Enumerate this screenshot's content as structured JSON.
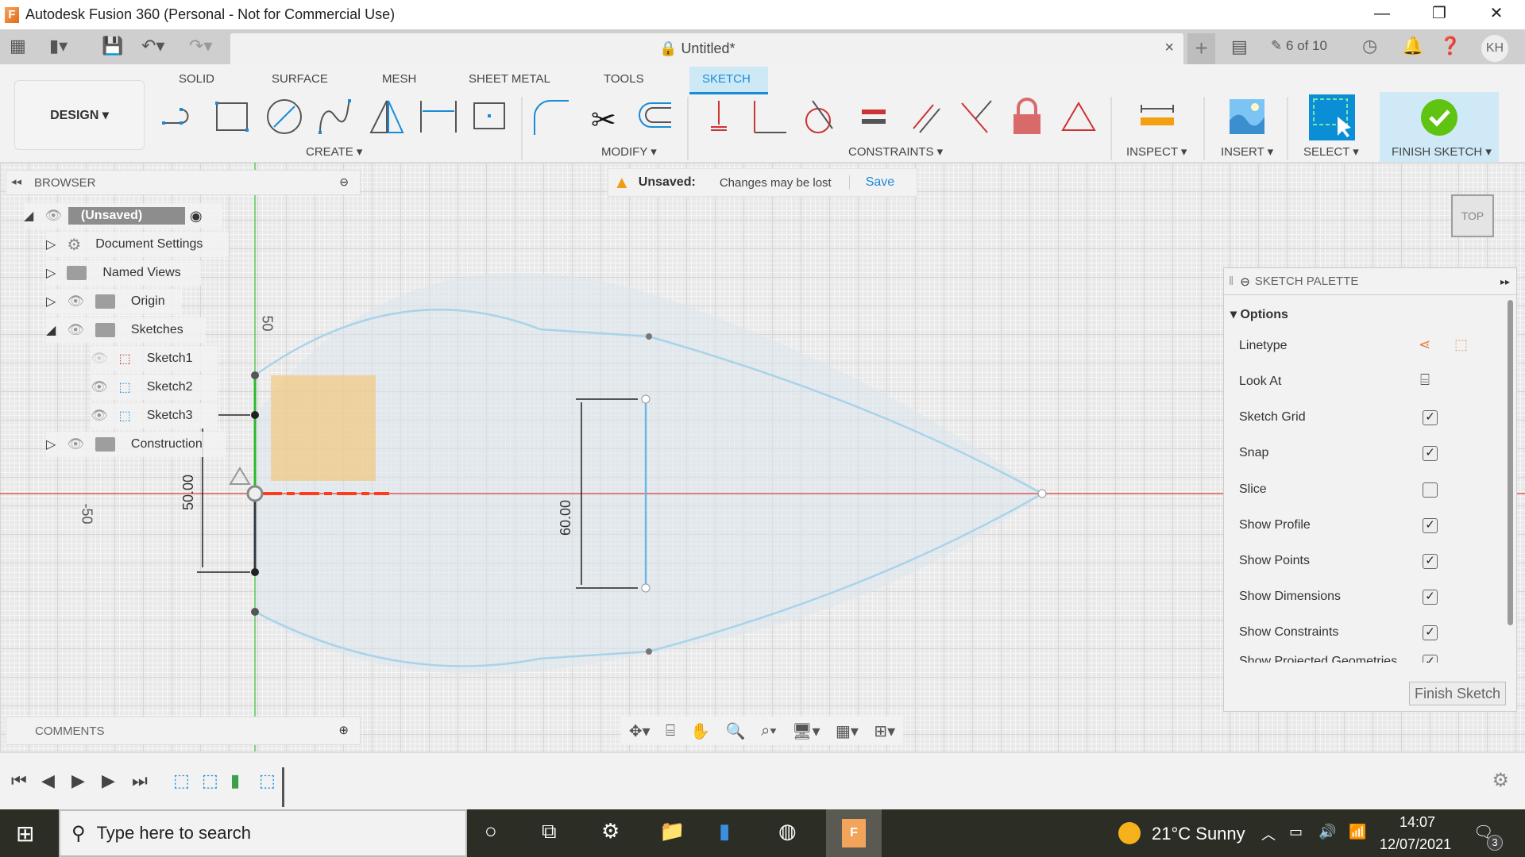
{
  "window": {
    "title": "Autodesk Fusion 360 (Personal - Not for Commercial Use)",
    "minimize": "—",
    "restore": "❐",
    "close": "✕"
  },
  "doc": {
    "tab_title": "Untitled*",
    "close": "×",
    "versions": "6 of 10",
    "user_initials": "KH"
  },
  "tabs": [
    {
      "label": "SOLID"
    },
    {
      "label": "SURFACE"
    },
    {
      "label": "MESH"
    },
    {
      "label": "SHEET METAL"
    },
    {
      "label": "TOOLS"
    },
    {
      "label": "SKETCH",
      "active": true
    }
  ],
  "workspace": "DESIGN ▾",
  "groups": {
    "create": "CREATE ▾",
    "modify": "MODIFY ▾",
    "constraints": "CONSTRAINTS ▾",
    "inspect": "INSPECT ▾",
    "insert": "INSERT ▾",
    "select": "SELECT ▾",
    "finish": "FINISH SKETCH ▾"
  },
  "unsaved_bar": {
    "label": "Unsaved:",
    "message": "Changes may be lost",
    "action": "Save"
  },
  "browser": {
    "title": "BROWSER",
    "root": "(Unsaved)",
    "items": [
      {
        "label": "Document Settings"
      },
      {
        "label": "Named Views"
      },
      {
        "label": "Origin"
      },
      {
        "label": "Sketches"
      },
      {
        "label": "Sketch1"
      },
      {
        "label": "Sketch2"
      },
      {
        "label": "Sketch3"
      },
      {
        "label": "Construction"
      }
    ]
  },
  "canvas": {
    "axis_label_top": "50",
    "axis_label_left": "-50",
    "dim_left": "50.00",
    "dim_center": "60.00",
    "viewcube": "TOP",
    "colors": {
      "profile": "#a9d3ea",
      "x_axis": "#e23b3b",
      "y_axis": "#39c33b",
      "fill": "#f2c97f"
    }
  },
  "palette": {
    "title": "SKETCH PALETTE",
    "section": "Options",
    "rows": [
      {
        "label": "Linetype",
        "type": "icons"
      },
      {
        "label": "Look At",
        "type": "icon"
      },
      {
        "label": "Sketch Grid",
        "checked": true
      },
      {
        "label": "Snap",
        "checked": true
      },
      {
        "label": "Slice",
        "checked": false
      },
      {
        "label": "Show Profile",
        "checked": true
      },
      {
        "label": "Show Points",
        "checked": true
      },
      {
        "label": "Show Dimensions",
        "checked": true
      },
      {
        "label": "Show Constraints",
        "checked": true
      },
      {
        "label": "Show Projected Geometries",
        "checked": true
      }
    ],
    "finish": "Finish Sketch"
  },
  "comments": {
    "title": "COMMENTS"
  },
  "taskbar": {
    "search_placeholder": "Type here to search",
    "weather": "21°C  Sunny",
    "time": "14:07",
    "date": "12/07/2021",
    "notifications": "3"
  }
}
